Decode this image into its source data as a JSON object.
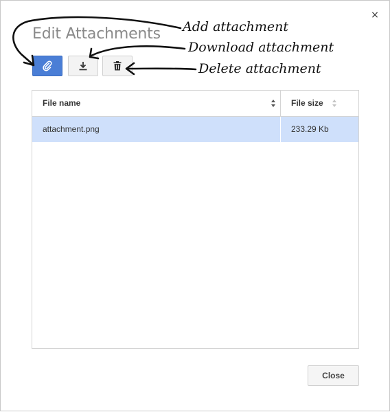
{
  "dialog": {
    "title": "Edit Attachments",
    "close_glyph": "×",
    "close_button_label": "Close"
  },
  "toolbar": {
    "add_icon": "paperclip-icon",
    "download_icon": "download-icon",
    "delete_icon": "trash-icon",
    "accent_color": "#4a7ed6"
  },
  "table": {
    "columns": [
      "File name",
      "File size"
    ],
    "rows": [
      {
        "name": "attachment.png",
        "size": "233.29 Kb",
        "selected": true
      }
    ],
    "selected_row_color": "#cfe0fb"
  },
  "annotations": {
    "add": "Add attachment",
    "download": "Download attachment",
    "delete": "Delete attachment"
  }
}
